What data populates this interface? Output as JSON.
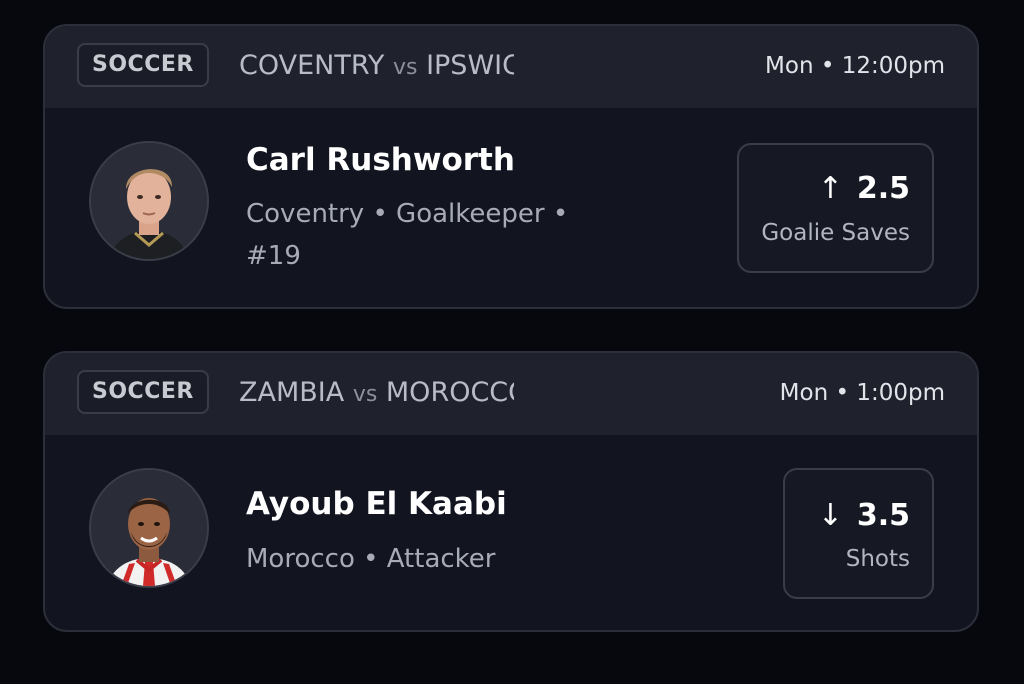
{
  "picks": [
    {
      "sport": "SOCCER",
      "team_a": "COVENTRY",
      "vs": "vs",
      "team_b": "IPSWICH",
      "time": "Mon • 12:00pm",
      "player_name": "Carl Rushworth",
      "player_info": "Coventry • Goalkeeper • #19",
      "direction": "up",
      "direction_icon": "arrow-up-icon",
      "line": "2.5",
      "stat": "Goalie Saves"
    },
    {
      "sport": "SOCCER",
      "team_a": "ZAMBIA",
      "vs": "vs",
      "team_b": "MOROCCO",
      "time": "Mon • 1:00pm",
      "player_name": "Ayoub El Kaabi",
      "player_info": "Morocco • Attacker",
      "direction": "down",
      "direction_icon": "arrow-down-icon",
      "line": "3.5",
      "stat": "Shots"
    }
  ],
  "colors": {
    "page_bg": "#07080e",
    "card_bg": "#121520",
    "header_bg": "#1f222c",
    "text_primary": "#ffffff",
    "text_secondary": "#a8abb5"
  }
}
